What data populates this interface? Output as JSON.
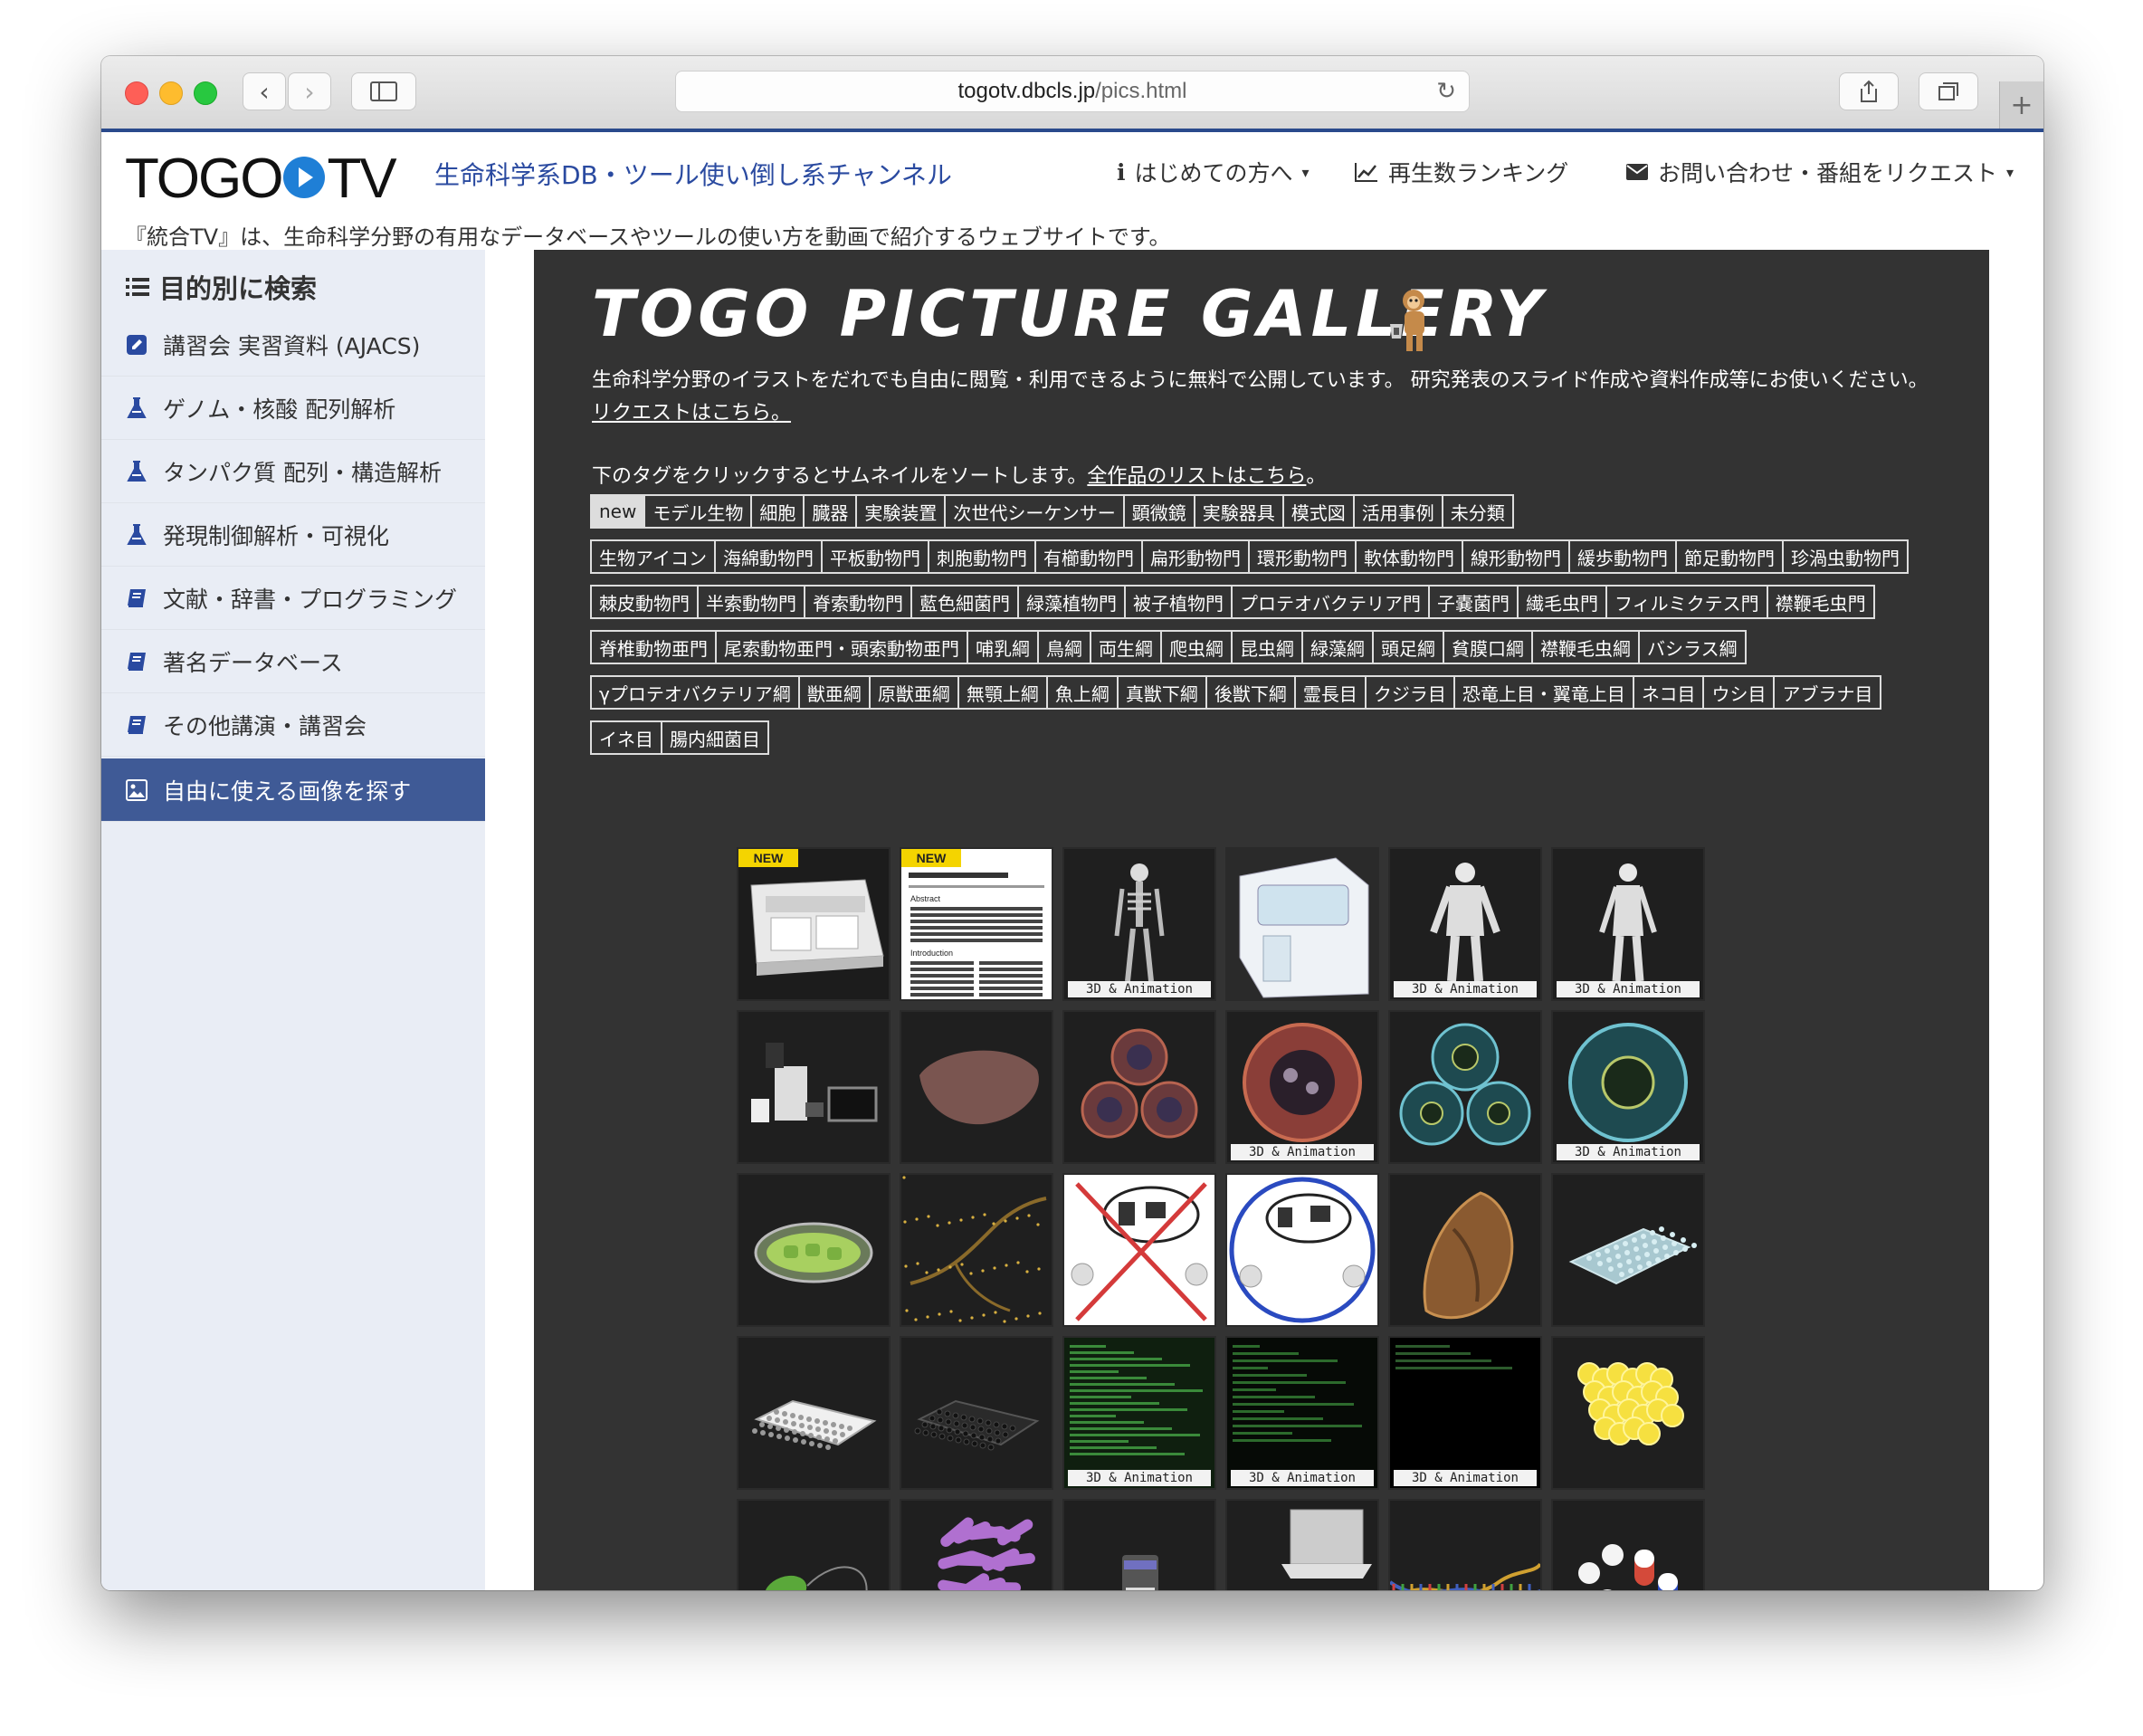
{
  "browser": {
    "url": "togotv.dbcls.jp/pics.html",
    "url_domain": "togotv.dbcls.jp",
    "url_path": "/pics.html"
  },
  "header": {
    "logo_left": "TOGO",
    "logo_right": "TV",
    "tagline": "生命科学系DB・ツール使い倒し系チャンネル",
    "nav": [
      {
        "label": "はじめての方へ",
        "icon": "info-icon"
      },
      {
        "label": "再生数ランキング",
        "icon": "chart-icon"
      },
      {
        "label": "お問い合わせ・番組をリクエスト",
        "icon": "mail-icon"
      }
    ],
    "description": "『統合TV』は、生命科学分野の有用なデータベースやツールの使い方を動画で紹介するウェブサイトです。"
  },
  "sidebar": {
    "title": "目的別に検索",
    "items": [
      {
        "label": "講習会 実習資料 (AJACS)",
        "icon": "edit-icon"
      },
      {
        "label": "ゲノム・核酸 配列解析",
        "icon": "flask-icon"
      },
      {
        "label": "タンパク質 配列・構造解析",
        "icon": "flask-icon"
      },
      {
        "label": "発現制御解析・可視化",
        "icon": "flask-icon"
      },
      {
        "label": "文献・辞書・プログラミング",
        "icon": "book-icon"
      },
      {
        "label": "著名データベース",
        "icon": "book-icon"
      },
      {
        "label": "その他講演・講習会",
        "icon": "book-icon"
      },
      {
        "label": "自由に使える画像を探す",
        "icon": "image-icon",
        "active": true
      }
    ]
  },
  "gallery": {
    "title": "TOGO PICTURE GALLERY",
    "intro": "生命科学分野のイラストをだれでも自由に閲覧・利用できるように無料で公開しています。 研究発表のスライド作成や資料作成等にお使いください。",
    "request_link": "リクエストはこちら。",
    "sort_text": "下のタグをクリックするとサムネイルをソートします。",
    "list_link": "全作品のリストはこちら",
    "list_link_suffix": "。",
    "tags": [
      [
        "new",
        "モデル生物",
        "細胞",
        "臓器",
        "実験装置",
        "次世代シーケンサー",
        "顕微鏡",
        "実験器具",
        "模式図",
        "活用事例",
        "未分類"
      ],
      [
        "生物アイコン",
        "海綿動物門",
        "平板動物門",
        "刺胞動物門",
        "有櫛動物門",
        "扁形動物門",
        "環形動物門",
        "軟体動物門",
        "線形動物門",
        "緩歩動物門",
        "節足動物門",
        "珍渦虫動物門"
      ],
      [
        "棘皮動物門",
        "半索動物門",
        "脊索動物門",
        "藍色細菌門",
        "緑藻植物門",
        "被子植物門",
        "プロテオバクテリア門",
        "子嚢菌門",
        "繊毛虫門",
        "フィルミクテス門",
        "襟鞭毛虫門"
      ],
      [
        "脊椎動物亜門",
        "尾索動物亜門・頭索動物亜門",
        "哺乳綱",
        "鳥綱",
        "両生綱",
        "爬虫綱",
        "昆虫綱",
        "緑藻綱",
        "頭足綱",
        "貧膜口綱",
        "襟鞭毛虫綱",
        "バシラス綱"
      ],
      [
        "γプロテオバクテリア綱",
        "獣亜綱",
        "原獣亜綱",
        "無顎上綱",
        "魚上綱",
        "真獣下綱",
        "後獣下綱",
        "霊長目",
        "クジラ目",
        "恐竜上目・翼竜上目",
        "ネコ目",
        "ウシ目",
        "アブラナ目"
      ],
      [
        "イネ目",
        "腸内細菌目"
      ]
    ],
    "badge_3d": "3D & Animation",
    "badge_new": "NEW",
    "thumbnails": [
      {
        "subject": "sequencer-flowcell",
        "new": true,
        "anim": false
      },
      {
        "subject": "paper-document",
        "new": true,
        "anim": false
      },
      {
        "subject": "human-skeleton",
        "new": false,
        "anim": true
      },
      {
        "subject": "cryostat-machine",
        "new": false,
        "anim": false
      },
      {
        "subject": "human-male-body",
        "new": false,
        "anim": true
      },
      {
        "subject": "human-female-body",
        "new": false,
        "anim": true
      },
      {
        "subject": "microscope-system",
        "new": false,
        "anim": false
      },
      {
        "subject": "liver-organ",
        "new": false,
        "anim": false
      },
      {
        "subject": "cell-cluster-red",
        "new": false,
        "anim": false
      },
      {
        "subject": "cell-red",
        "new": false,
        "anim": true
      },
      {
        "subject": "cell-cluster-blue",
        "new": false,
        "anim": false
      },
      {
        "subject": "cell-blue",
        "new": false,
        "anim": true
      },
      {
        "subject": "chloroplast",
        "new": false,
        "anim": false
      },
      {
        "subject": "fungal-hyphae",
        "new": false,
        "anim": false
      },
      {
        "subject": "sns-bad-example",
        "new": false,
        "anim": false
      },
      {
        "subject": "sns-good-example",
        "new": false,
        "anim": false
      },
      {
        "subject": "insect-moth",
        "new": false,
        "anim": false
      },
      {
        "subject": "well-plate-clear",
        "new": false,
        "anim": false
      },
      {
        "subject": "well-plate-white",
        "new": false,
        "anim": false
      },
      {
        "subject": "well-plate-black",
        "new": false,
        "anim": false
      },
      {
        "subject": "terminal-green",
        "new": false,
        "anim": true
      },
      {
        "subject": "terminal-dark",
        "new": false,
        "anim": true
      },
      {
        "subject": "terminal-black",
        "new": false,
        "anim": true
      },
      {
        "subject": "yellow-beads",
        "new": false,
        "anim": false
      },
      {
        "subject": "bacterium-green",
        "new": false,
        "anim": false
      },
      {
        "subject": "purple-crystals",
        "new": false,
        "anim": false
      },
      {
        "subject": "sequencer-device",
        "new": false,
        "anim": false
      },
      {
        "subject": "laptop-sequencer",
        "new": false,
        "anim": false
      },
      {
        "subject": "dna-helix",
        "new": false,
        "anim": false
      },
      {
        "subject": "pills-capsules",
        "new": false,
        "anim": false
      }
    ]
  },
  "colors": {
    "brand_blue": "#2a4a8c",
    "sidebar_bg": "#e9edf5",
    "sidebar_active": "#3f5a96",
    "gallery_bg": "#333333",
    "new_badge": "#f4d400"
  }
}
